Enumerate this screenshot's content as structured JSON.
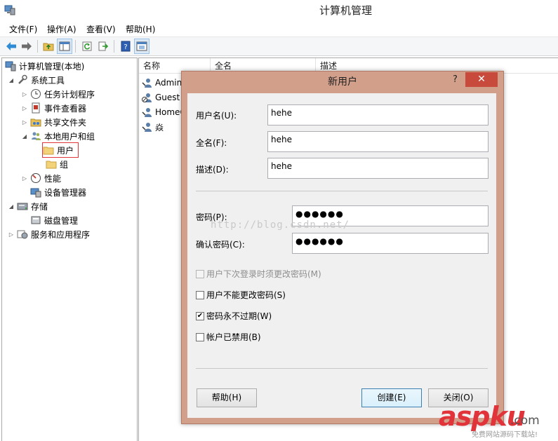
{
  "window": {
    "title": "计算机管理"
  },
  "menu": [
    "文件(F)",
    "操作(A)",
    "查看(V)",
    "帮助(H)"
  ],
  "toolbar": {
    "icons": [
      "back-icon",
      "forward-icon",
      "up-folder-icon",
      "show-hide-tree-icon",
      "refresh-icon",
      "export-icon",
      "help-icon",
      "properties-icon"
    ]
  },
  "tree": {
    "root": "计算机管理(本地)",
    "system_tools": "系统工具",
    "task_scheduler": "任务计划程序",
    "event_viewer": "事件查看器",
    "shared_folders": "共享文件夹",
    "local_users_groups": "本地用户和组",
    "users": "用户",
    "groups": "组",
    "performance": "性能",
    "device_manager": "设备管理器",
    "storage": "存储",
    "disk_management": "磁盘管理",
    "services_apps": "服务和应用程序"
  },
  "list": {
    "headers": [
      "名称",
      "全名",
      "描述"
    ],
    "rows": [
      "Admini",
      "Guest",
      "HomeG",
      "焱"
    ]
  },
  "dialog": {
    "title": "新用户",
    "help": "?",
    "close": "✕",
    "username_label": "用户名(U):",
    "username_value": "hehe",
    "fullname_label": "全名(F):",
    "fullname_value": "hehe",
    "description_label": "描述(D):",
    "description_value": "hehe",
    "password_label": "密码(P):",
    "password_value": "●●●●●●",
    "confirm_label": "确认密码(C):",
    "confirm_value": "●●●●●●",
    "chk_must_change": "用户下次登录时须更改密码(M)",
    "chk_cannot_change": "用户不能更改密码(S)",
    "chk_never_expires": "密码永不过期(W)",
    "chk_disabled": "帐户已禁用(B)",
    "checks": {
      "must_change": false,
      "cannot_change": false,
      "never_expires": true,
      "disabled": false
    },
    "help_button": "帮助(H)",
    "create_button": "创建(E)",
    "close_button": "关闭(O)"
  },
  "watermark": "http://blog.csdn.net/",
  "logo": {
    "main": "aspku",
    "tld": ".com",
    "sub": "免费网站源码下载站!"
  },
  "colors": {
    "dialog_frame": "#d29f8a",
    "close_button": "#c74a3c",
    "tree_highlight": "#e0363c",
    "logo": "#e0343a"
  }
}
